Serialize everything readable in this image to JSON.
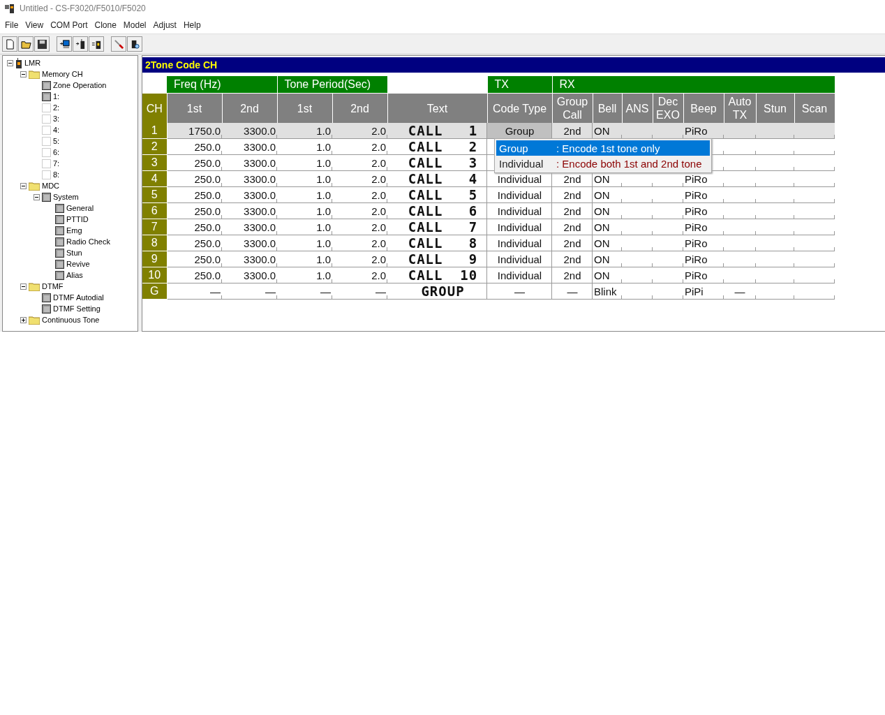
{
  "window": {
    "title": "Untitled - CS-F3020/F5010/F5020"
  },
  "menu": [
    "File",
    "View",
    "COM Port",
    "Clone",
    "Model",
    "Adjust",
    "Help"
  ],
  "toolbar": [
    {
      "kind": "new"
    },
    {
      "kind": "open"
    },
    {
      "kind": "save"
    },
    {
      "kind": "sep"
    },
    {
      "kind": "read"
    },
    {
      "kind": "write"
    },
    {
      "kind": "clone"
    },
    {
      "kind": "sep"
    },
    {
      "kind": "adjust"
    },
    {
      "kind": "search"
    }
  ],
  "tree": [
    {
      "label": "LMR",
      "kind": "radio",
      "expanded": true,
      "children": [
        {
          "label": "Memory CH",
          "kind": "folder",
          "expanded": true,
          "children": [
            {
              "label": "Zone Operation",
              "kind": "page"
            },
            {
              "label": "1:",
              "kind": "page"
            },
            {
              "label": "2:",
              "kind": "empty"
            },
            {
              "label": "3:",
              "kind": "empty"
            },
            {
              "label": "4:",
              "kind": "empty"
            },
            {
              "label": "5:",
              "kind": "empty"
            },
            {
              "label": "6:",
              "kind": "empty"
            },
            {
              "label": "7:",
              "kind": "empty"
            },
            {
              "label": "8:",
              "kind": "empty"
            }
          ]
        },
        {
          "label": "MDC",
          "kind": "folder",
          "expanded": true,
          "children": [
            {
              "label": "System",
              "kind": "page",
              "expanded": true,
              "children": [
                {
                  "label": "General",
                  "kind": "page"
                },
                {
                  "label": "PTTID",
                  "kind": "page"
                },
                {
                  "label": "Emg",
                  "kind": "page"
                },
                {
                  "label": "Radio Check",
                  "kind": "page"
                },
                {
                  "label": "Stun",
                  "kind": "page"
                },
                {
                  "label": "Revive",
                  "kind": "page"
                },
                {
                  "label": "Alias",
                  "kind": "page"
                }
              ]
            }
          ]
        },
        {
          "label": "DTMF",
          "kind": "folder",
          "expanded": true,
          "children": [
            {
              "label": "DTMF Autodial",
              "kind": "page"
            },
            {
              "label": "DTMF Setting",
              "kind": "page"
            }
          ]
        },
        {
          "label": "Continuous Tone",
          "kind": "folder",
          "expanded": false
        }
      ]
    }
  ],
  "panel": {
    "title": "2Tone Code CH"
  },
  "table": {
    "groups": [
      {
        "label": "Freq (Hz)"
      },
      {
        "label": "Tone Period(Sec)"
      },
      {
        "label": "TX"
      },
      {
        "label": "RX"
      }
    ],
    "columns": [
      "CH",
      "1st",
      "2nd",
      "1st",
      "2nd",
      "Text",
      "Code Type",
      "Group\nCall",
      "Bell",
      "ANS",
      "Dec\nEXO",
      "Beep",
      "Auto\nTX",
      "Stun",
      "Scan"
    ],
    "rows": [
      {
        "selected": true,
        "cells": [
          "1",
          "1750.0",
          "3300.0",
          "1.0",
          "2.0",
          "CALL   1",
          "Group",
          "2nd",
          "ON",
          "",
          "",
          "PiRo",
          "",
          "",
          ""
        ]
      },
      {
        "selected": false,
        "cells": [
          "2",
          "250.0",
          "3300.0",
          "1.0",
          "2.0",
          "CALL   2",
          null,
          null,
          null,
          "",
          "",
          null,
          "",
          "",
          ""
        ]
      },
      {
        "selected": false,
        "cells": [
          "3",
          "250.0",
          "3300.0",
          "1.0",
          "2.0",
          "CALL   3",
          null,
          null,
          null,
          "",
          "",
          null,
          "",
          "",
          ""
        ]
      },
      {
        "selected": false,
        "cells": [
          "4",
          "250.0",
          "3300.0",
          "1.0",
          "2.0",
          "CALL   4",
          "Individual",
          "2nd",
          "ON",
          "",
          "",
          "PiRo",
          "",
          "",
          ""
        ]
      },
      {
        "selected": false,
        "cells": [
          "5",
          "250.0",
          "3300.0",
          "1.0",
          "2.0",
          "CALL   5",
          "Individual",
          "2nd",
          "ON",
          "",
          "",
          "PiRo",
          "",
          "",
          ""
        ]
      },
      {
        "selected": false,
        "cells": [
          "6",
          "250.0",
          "3300.0",
          "1.0",
          "2.0",
          "CALL   6",
          "Individual",
          "2nd",
          "ON",
          "",
          "",
          "PiRo",
          "",
          "",
          ""
        ]
      },
      {
        "selected": false,
        "cells": [
          "7",
          "250.0",
          "3300.0",
          "1.0",
          "2.0",
          "CALL   7",
          "Individual",
          "2nd",
          "ON",
          "",
          "",
          "PiRo",
          "",
          "",
          ""
        ]
      },
      {
        "selected": false,
        "cells": [
          "8",
          "250.0",
          "3300.0",
          "1.0",
          "2.0",
          "CALL   8",
          "Individual",
          "2nd",
          "ON",
          "",
          "",
          "PiRo",
          "",
          "",
          ""
        ]
      },
      {
        "selected": false,
        "cells": [
          "9",
          "250.0",
          "3300.0",
          "1.0",
          "2.0",
          "CALL   9",
          "Individual",
          "2nd",
          "ON",
          "",
          "",
          "PiRo",
          "",
          "",
          ""
        ]
      },
      {
        "selected": false,
        "cells": [
          "10",
          "250.0",
          "3300.0",
          "1.0",
          "2.0",
          "CALL  10",
          "Individual",
          "2nd",
          "ON",
          "",
          "",
          "PiRo",
          "",
          "",
          ""
        ]
      },
      {
        "selected": false,
        "cells": [
          "G",
          "—",
          "—",
          "—",
          "—",
          "GROUP",
          "—",
          "—",
          "Blink",
          "",
          "",
          "PiPi",
          "—",
          "",
          ""
        ]
      }
    ]
  },
  "dropdown": [
    {
      "value": "Group",
      "description": ": Encode 1st tone only",
      "selected": true
    },
    {
      "value": "Individual",
      "description": ": Encode both 1st and 2nd tone",
      "selected": false
    }
  ]
}
